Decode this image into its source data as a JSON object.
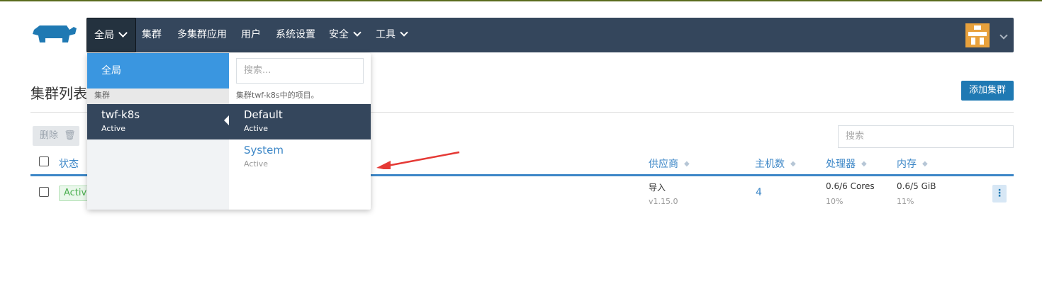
{
  "header": {
    "nav_items": [
      {
        "label": "全局"
      },
      {
        "label": "集群"
      },
      {
        "label": "多集群应用"
      },
      {
        "label": "用户"
      },
      {
        "label": "系统设置"
      },
      {
        "label": "安全"
      },
      {
        "label": "工具"
      }
    ]
  },
  "page": {
    "title": "集群列表",
    "add_button": "添加集群",
    "delete_button": "删除",
    "search_placeholder": "搜索"
  },
  "table": {
    "columns": [
      "状态",
      "供应商",
      "主机数",
      "处理器",
      "内存"
    ],
    "rows": [
      {
        "status": "Active",
        "provider": "导入",
        "version": "v1.15.0",
        "hosts": "4",
        "cpu": "0.6/6 Cores",
        "cpu_pct": "10%",
        "memory": "0.6/5 GiB",
        "memory_pct": "11%"
      }
    ]
  },
  "dropdown": {
    "global_label": "全局",
    "search_placeholder": "搜索...",
    "cluster_section": "集群",
    "project_hint": "集群twf-k8s中的项目。",
    "cluster": {
      "name": "twf-k8s",
      "status": "Active"
    },
    "projects": [
      {
        "name": "Default",
        "status": "Active"
      },
      {
        "name": "System",
        "status": "Active"
      }
    ]
  },
  "colors": {
    "navbar": "#34465c",
    "accent": "#3d87c7",
    "primary_button": "#1f79b3",
    "active_green": "#4caf50",
    "annotation_arrow": "#e53935"
  }
}
